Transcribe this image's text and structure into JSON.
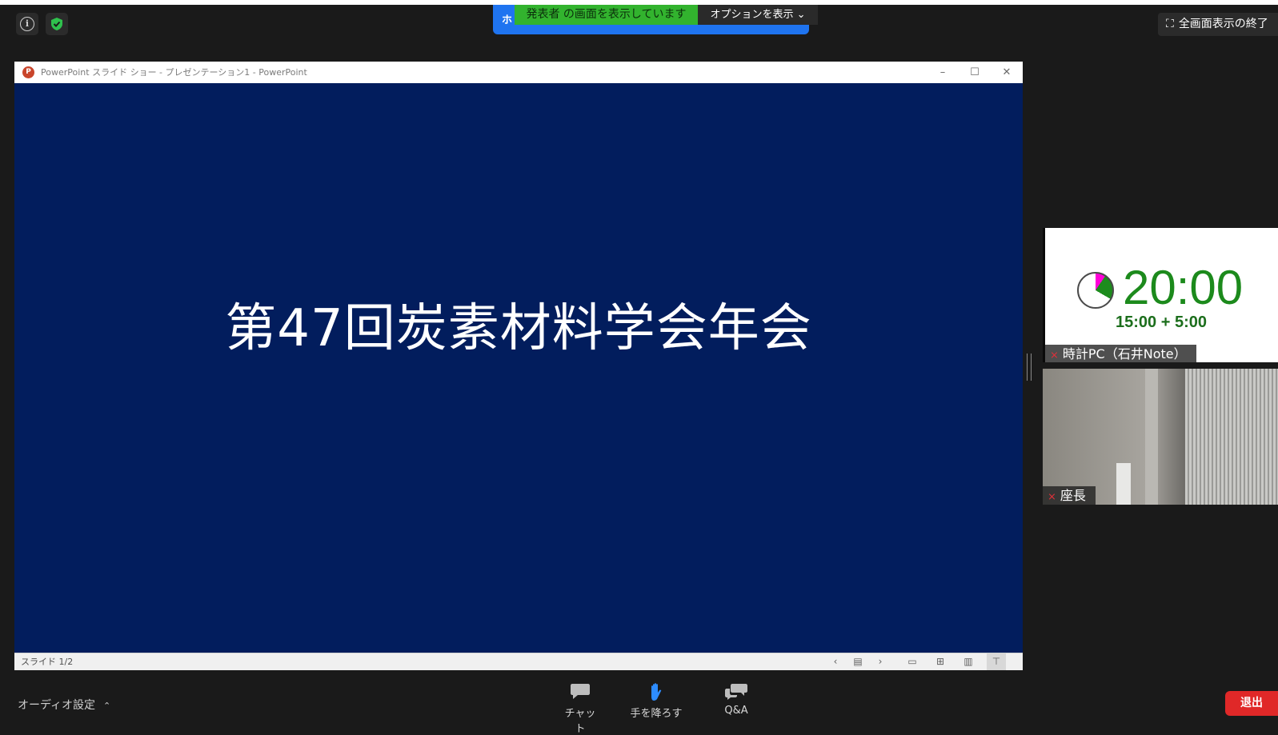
{
  "top_left": {
    "info_icon": "info-icon",
    "security_icon": "shield-check-icon",
    "security_color": "#2fc14d"
  },
  "share_banner": {
    "host_prefix": "ホ",
    "viewing_text": "発表者 の画面を表示しています",
    "options_label": "オプションを表示 ⌄",
    "banner_color": "#1f74f0",
    "viewing_color": "#32b32e"
  },
  "exit_fullscreen": {
    "label": "全画面表示の終了",
    "icon": "exit-fullscreen-icon"
  },
  "ppt": {
    "window_title": "PowerPoint スライド ショー - プレゼンテーション1 - PowerPoint",
    "min_label": "–",
    "max_label": "☐",
    "close_label": "✕",
    "slide_title": "第47回炭素材料学会年会",
    "slide_bg": "#021d5d",
    "slide_counter": "スライド 1/2"
  },
  "participants": {
    "timer": {
      "time": "20:00",
      "breakdown": "15:00 + 5:00",
      "name": "時計PC（石井Note）",
      "muted": true
    },
    "chair": {
      "name": "座長",
      "muted": true
    }
  },
  "toolbar": {
    "audio_label": "オーディオ設定",
    "chat_label": "チャット",
    "hand_label": "手を降ろす",
    "qa_label": "Q&A",
    "leave_label": "退出",
    "leave_color": "#e02828"
  }
}
